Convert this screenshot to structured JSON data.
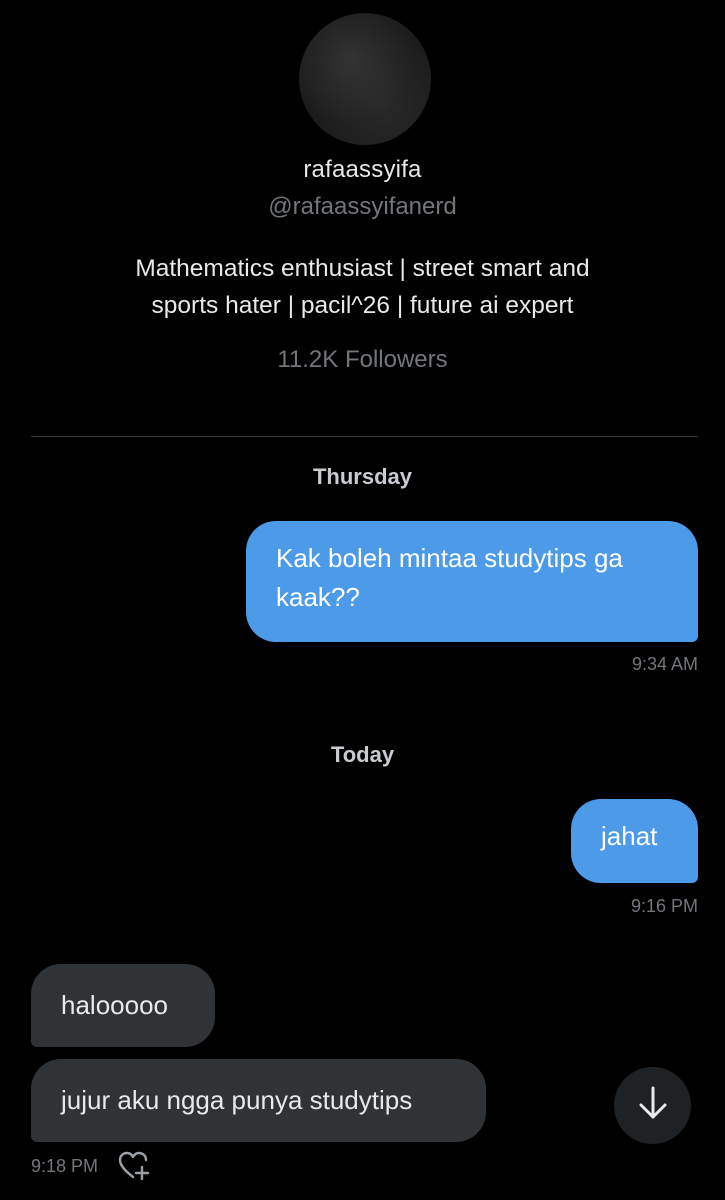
{
  "profile": {
    "display_name": "rafaassyifa",
    "handle": "@rafaassyifanerd",
    "bio_line1": "Mathematics enthusiast | street smart and",
    "bio_line2": "sports hater | pacil^26 | future ai expert",
    "followers": "11.2K Followers"
  },
  "conversation": {
    "days": [
      {
        "label": "Thursday",
        "messages": [
          {
            "direction": "outgoing",
            "text": "Kak boleh mintaa studytips ga kaak??",
            "time": "9:34 AM"
          }
        ]
      },
      {
        "label": "Today",
        "messages": [
          {
            "direction": "outgoing",
            "text": "jahat",
            "time": "9:16 PM"
          },
          {
            "direction": "incoming",
            "text": "halooooo"
          },
          {
            "direction": "incoming",
            "text": "jujur aku ngga punya studytips",
            "time": "9:18 PM"
          }
        ]
      }
    ]
  },
  "icons": {
    "react": "heart-plus-icon",
    "scroll": "arrow-down-icon"
  },
  "colors": {
    "background": "#000000",
    "outgoing_bubble": "#4c9ae8",
    "incoming_bubble": "#2f3336",
    "muted_text": "#71767b"
  }
}
